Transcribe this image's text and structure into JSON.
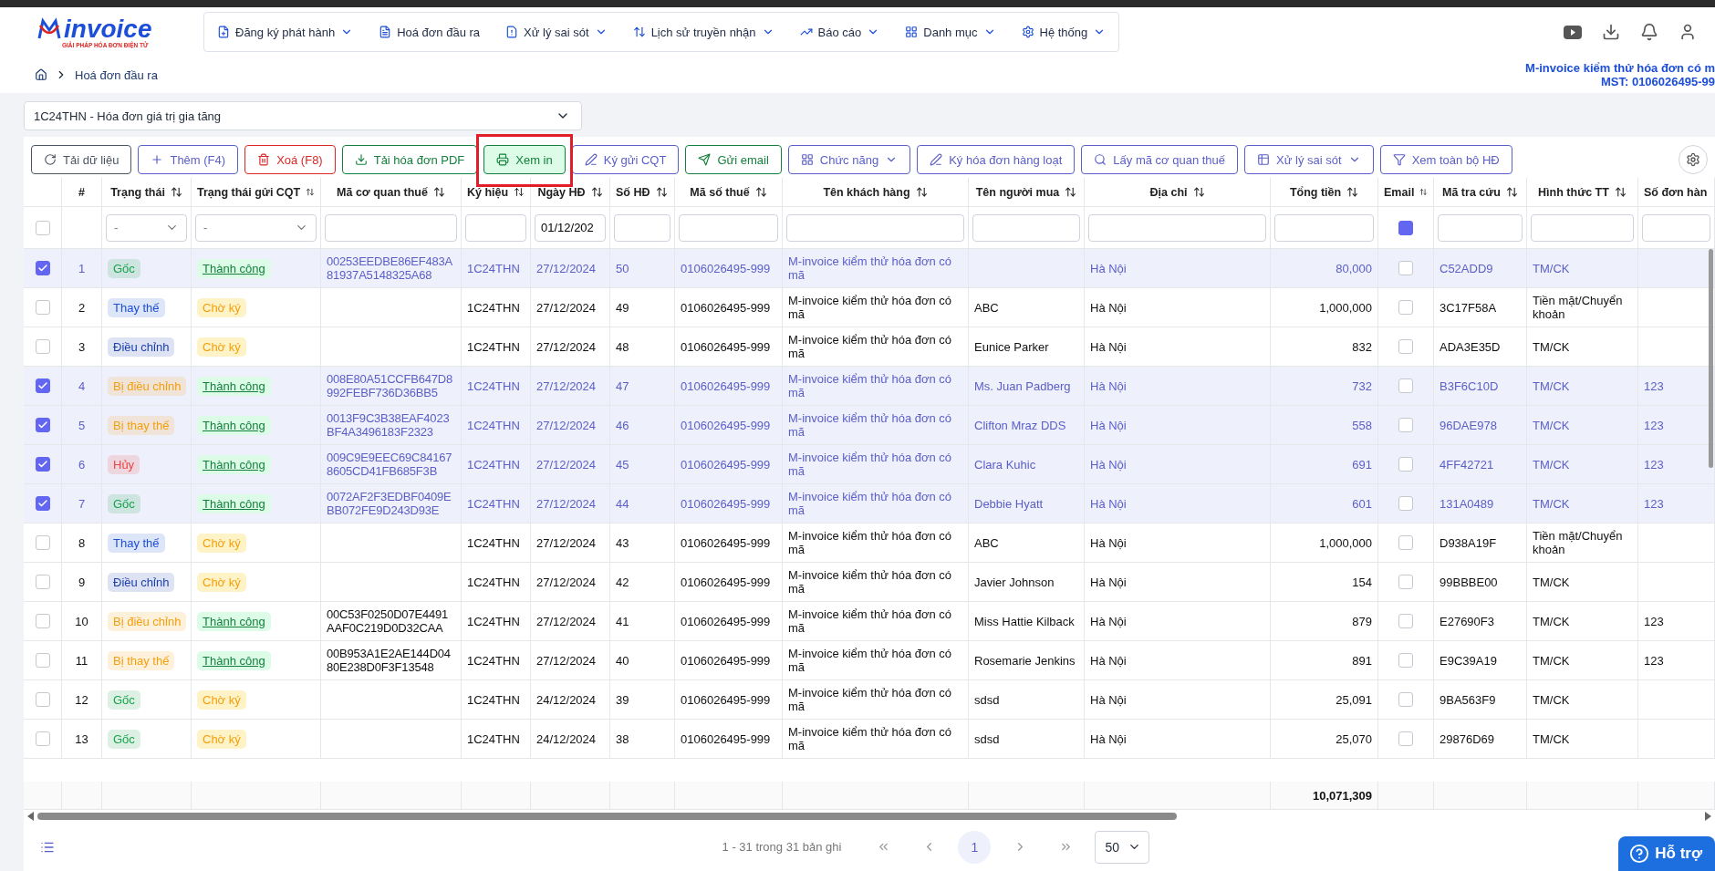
{
  "logo": {
    "text": "invoice",
    "tagline": "GIẢI PHÁP HÓA ĐƠN ĐIỆN TỬ"
  },
  "nav": [
    {
      "label": "Đăng ký phát hành",
      "dropdown": true
    },
    {
      "label": "Hoá đơn đầu ra",
      "dropdown": false
    },
    {
      "label": "Xử lý sai sót",
      "dropdown": true
    },
    {
      "label": "Lịch sử truyền nhận",
      "dropdown": true
    },
    {
      "label": "Báo cáo",
      "dropdown": true
    },
    {
      "label": "Danh mục",
      "dropdown": true
    },
    {
      "label": "Hệ thống",
      "dropdown": true
    }
  ],
  "breadcrumb": [
    "Hoá đơn đầu ra"
  ],
  "company": {
    "name": "M-invoice kiểm thử hóa đơn có m",
    "tax_code": "MST: 0106026495-99"
  },
  "series_select": {
    "value": "1C24THN - Hóa đơn giá trị gia tăng"
  },
  "toolbar": [
    {
      "label": "Tải dữ liệu",
      "color": "#4b5563",
      "dropdown": false,
      "selected": false
    },
    {
      "label": "Thêm (F4)",
      "color": "#5b5fc7",
      "dropdown": false,
      "selected": false
    },
    {
      "label": "Xoá (F8)",
      "color": "#dc2626",
      "dropdown": false,
      "selected": false
    },
    {
      "label": "Tải hóa đơn PDF",
      "color": "#15803d",
      "dropdown": false,
      "selected": false
    },
    {
      "label": "Xem in",
      "color": "#15803d",
      "dropdown": false,
      "selected": true
    },
    {
      "label": "Ký gửi CQT",
      "color": "#5b5fc7",
      "dropdown": false,
      "selected": false
    },
    {
      "label": "Gửi email",
      "color": "#15803d",
      "dropdown": false,
      "selected": false
    },
    {
      "label": "Chức năng",
      "color": "#5b5fc7",
      "dropdown": true,
      "selected": false
    },
    {
      "label": "Ký hóa đơn hàng loạt",
      "color": "#5b5fc7",
      "dropdown": false,
      "selected": false
    },
    {
      "label": "Lấy mã cơ quan thuế",
      "color": "#5b5fc7",
      "dropdown": false,
      "selected": false
    },
    {
      "label": "Xử lý sai sót",
      "color": "#5b5fc7",
      "dropdown": true,
      "selected": false
    },
    {
      "label": "Xem toàn bộ HĐ",
      "color": "#5b5fc7",
      "dropdown": false,
      "selected": false
    }
  ],
  "table": {
    "columns": [
      {
        "sortable": false
      },
      {
        "label": "#",
        "sortable": false
      },
      {
        "label": "Trạng thái",
        "sortable": true
      },
      {
        "label": "Trạng thái gửi CQT",
        "sortable": true
      },
      {
        "label": "Mã cơ quan thuế",
        "sortable": true
      },
      {
        "label": "Ký hiệu",
        "sortable": true
      },
      {
        "label": "Ngày HĐ",
        "sortable": true
      },
      {
        "label": "Số HĐ",
        "sortable": true
      },
      {
        "label": "Mã số thuế",
        "sortable": true
      },
      {
        "label": "Tên khách hàng",
        "sortable": true
      },
      {
        "label": "Tên người mua",
        "sortable": true
      },
      {
        "label": "Địa chỉ",
        "sortable": true
      },
      {
        "label": "Tổng tiền",
        "sortable": true
      },
      {
        "label": "Email",
        "sortable": true
      },
      {
        "label": "Mã tra cứu",
        "sortable": true
      },
      {
        "label": "Hình thức TT",
        "sortable": true
      },
      {
        "label": "Số đơn hàn"
      }
    ],
    "filters": [
      {
        "kind": "checkbox",
        "checked": false
      },
      {
        "kind": "none"
      },
      {
        "kind": "select",
        "placeholder": "-"
      },
      {
        "kind": "select",
        "placeholder": "-"
      },
      {
        "kind": "input"
      },
      {
        "kind": "input"
      },
      {
        "kind": "input",
        "value": "01/12/202"
      },
      {
        "kind": "input"
      },
      {
        "kind": "input"
      },
      {
        "kind": "input"
      },
      {
        "kind": "input"
      },
      {
        "kind": "input"
      },
      {
        "kind": "input"
      },
      {
        "kind": "square",
        "checked": true
      },
      {
        "kind": "input"
      },
      {
        "kind": "input"
      },
      {
        "kind": "input"
      }
    ],
    "rows": [
      {
        "selected": true,
        "no": "1",
        "status": {
          "label": "Gốc",
          "color": "#16a34a"
        },
        "cqt": {
          "label": "Thành công",
          "kind": "success"
        },
        "code": "00253EEDBE86EF483A81937A5148325A68",
        "symbol": "1C24THN",
        "date": "27/12/2024",
        "number": "50",
        "tax_id": "0106026495-999",
        "customer": "M-invoice kiểm thử hóa đơn có mã",
        "address": "Hà Nội",
        "total": "80,000",
        "email": false,
        "lookup": "C52ADD9",
        "payment": "TM/CK"
      },
      {
        "selected": false,
        "no": "2",
        "status": {
          "label": "Thay thế",
          "color": "#1d4ed8"
        },
        "cqt": {
          "label": "Chờ ký",
          "kind": "pending"
        },
        "symbol": "1C24THN",
        "date": "27/12/2024",
        "number": "49",
        "tax_id": "0106026495-999",
        "customer": "M-invoice kiểm thử hóa đơn có mã",
        "buyer": "ABC",
        "address": "Hà Nội",
        "total": "1,000,000",
        "email": false,
        "lookup": "3C17F58A",
        "payment": "Tiền mặt/Chuyển khoản"
      },
      {
        "selected": false,
        "no": "3",
        "status": {
          "label": "Điều chỉnh",
          "color": "#1e40af"
        },
        "cqt": {
          "label": "Chờ ký",
          "kind": "pending"
        },
        "symbol": "1C24THN",
        "date": "27/12/2024",
        "number": "48",
        "tax_id": "0106026495-999",
        "customer": "M-invoice kiểm thử hóa đơn có mã",
        "buyer": "Eunice Parker",
        "address": "Hà Nội",
        "total": "832",
        "email": false,
        "lookup": "ADA3E35D",
        "payment": "TM/CK"
      },
      {
        "selected": true,
        "no": "4",
        "status": {
          "label": "Bị điều chỉnh",
          "color": "#f59e0b"
        },
        "cqt": {
          "label": "Thành công",
          "kind": "success"
        },
        "code": "008E80A51CCFB647D8992FEBF736D36BB5",
        "symbol": "1C24THN",
        "date": "27/12/2024",
        "number": "47",
        "tax_id": "0106026495-999",
        "customer": "M-invoice kiểm thử hóa đơn có mã",
        "buyer": "Ms. Juan Padberg",
        "address": "Hà Nội",
        "total": "732",
        "email": false,
        "lookup": "B3F6C10D",
        "payment": "TM/CK",
        "order": "123"
      },
      {
        "selected": true,
        "no": "5",
        "status": {
          "label": "Bị thay thế",
          "color": "#f59e0b"
        },
        "cqt": {
          "label": "Thành công",
          "kind": "success"
        },
        "code": "0013F9C3B38EAF4023BF4A3496183F2323",
        "symbol": "1C24THN",
        "date": "27/12/2024",
        "number": "46",
        "tax_id": "0106026495-999",
        "customer": "M-invoice kiểm thử hóa đơn có mã",
        "buyer": "Clifton Mraz DDS",
        "address": "Hà Nội",
        "total": "558",
        "email": false,
        "lookup": "96DAE978",
        "payment": "TM/CK",
        "order": "123"
      },
      {
        "selected": true,
        "no": "6",
        "status": {
          "label": "Hủy",
          "color": "#ef4444"
        },
        "cqt": {
          "label": "Thành công",
          "kind": "success"
        },
        "code": "009C9E9EEC69C841678605CD41FB685F3B",
        "symbol": "1C24THN",
        "date": "27/12/2024",
        "number": "45",
        "tax_id": "0106026495-999",
        "customer": "M-invoice kiểm thử hóa đơn có mã",
        "buyer": "Clara Kuhic",
        "address": "Hà Nội",
        "total": "691",
        "email": false,
        "lookup": "4FF42721",
        "payment": "TM/CK",
        "order": "123"
      },
      {
        "selected": true,
        "no": "7",
        "status": {
          "label": "Gốc",
          "color": "#16a34a"
        },
        "cqt": {
          "label": "Thành công",
          "kind": "success"
        },
        "code": "0072AF2F3EDBF0409EBB072FE9D243D93E",
        "symbol": "1C24THN",
        "date": "27/12/2024",
        "number": "44",
        "tax_id": "0106026495-999",
        "customer": "M-invoice kiểm thử hóa đơn có mã",
        "buyer": "Debbie Hyatt",
        "address": "Hà Nội",
        "total": "601",
        "email": false,
        "lookup": "131A0489",
        "payment": "TM/CK",
        "order": "123"
      },
      {
        "selected": false,
        "no": "8",
        "status": {
          "label": "Thay thế",
          "color": "#1d4ed8"
        },
        "cqt": {
          "label": "Chờ ký",
          "kind": "pending"
        },
        "symbol": "1C24THN",
        "date": "27/12/2024",
        "number": "43",
        "tax_id": "0106026495-999",
        "customer": "M-invoice kiểm thử hóa đơn có mã",
        "buyer": "ABC",
        "address": "Hà Nội",
        "total": "1,000,000",
        "email": false,
        "lookup": "D938A19F",
        "payment": "Tiền mặt/Chuyển khoản"
      },
      {
        "selected": false,
        "no": "9",
        "status": {
          "label": "Điều chỉnh",
          "color": "#1e40af"
        },
        "cqt": {
          "label": "Chờ ký",
          "kind": "pending"
        },
        "symbol": "1C24THN",
        "date": "27/12/2024",
        "number": "42",
        "tax_id": "0106026495-999",
        "customer": "M-invoice kiểm thử hóa đơn có mã",
        "buyer": "Javier Johnson",
        "address": "Hà Nội",
        "total": "154",
        "email": false,
        "lookup": "99BBBE00",
        "payment": "TM/CK"
      },
      {
        "selected": false,
        "no": "10",
        "status": {
          "label": "Bị điều chỉnh",
          "color": "#f59e0b"
        },
        "cqt": {
          "label": "Thành công",
          "kind": "success"
        },
        "code": "00C53F0250D07E4491AAF0C219D0D32CAA",
        "symbol": "1C24THN",
        "date": "27/12/2024",
        "number": "41",
        "tax_id": "0106026495-999",
        "customer": "M-invoice kiểm thử hóa đơn có mã",
        "buyer": "Miss Hattie Kilback",
        "address": "Hà Nội",
        "total": "879",
        "email": false,
        "lookup": "E27690F3",
        "payment": "TM/CK",
        "order": "123"
      },
      {
        "selected": false,
        "no": "11",
        "status": {
          "label": "Bị thay thế",
          "color": "#f59e0b"
        },
        "cqt": {
          "label": "Thành công",
          "kind": "success"
        },
        "code": "00B953A1E2AE144D0480E238D0F3F13548",
        "symbol": "1C24THN",
        "date": "27/12/2024",
        "number": "40",
        "tax_id": "0106026495-999",
        "customer": "M-invoice kiểm thử hóa đơn có mã",
        "buyer": "Rosemarie Jenkins",
        "address": "Hà Nội",
        "total": "891",
        "email": false,
        "lookup": "E9C39A19",
        "payment": "TM/CK",
        "order": "123"
      },
      {
        "selected": false,
        "no": "12",
        "status": {
          "label": "Gốc",
          "color": "#16a34a"
        },
        "cqt": {
          "label": "Chờ ký",
          "kind": "pending"
        },
        "symbol": "1C24THN",
        "date": "24/12/2024",
        "number": "39",
        "tax_id": "0106026495-999",
        "customer": "M-invoice kiểm thử hóa đơn có mã",
        "buyer": "sdsd",
        "address": "Hà Nội",
        "total": "25,091",
        "email": false,
        "lookup": "9BA563F9",
        "payment": "TM/CK"
      },
      {
        "selected": false,
        "no": "13",
        "status": {
          "label": "Gốc",
          "color": "#16a34a"
        },
        "cqt": {
          "label": "Chờ ký",
          "kind": "pending"
        },
        "symbol": "1C24THN",
        "date": "24/12/2024",
        "number": "38",
        "tax_id": "0106026495-999",
        "customer": "M-invoice kiểm thử hóa đơn có mã",
        "buyer": "sdsd",
        "address": "Hà Nội",
        "total": "25,070",
        "email": false,
        "lookup": "29876D69",
        "payment": "TM/CK"
      }
    ],
    "total": "10,071,309"
  },
  "pagination": {
    "summary": "1 - 31 trong 31 bản ghi",
    "pages": [
      {
        "label": "1",
        "selected": true
      }
    ],
    "page_size": "50"
  },
  "help_button": {
    "label": "Hỗ trợ"
  }
}
